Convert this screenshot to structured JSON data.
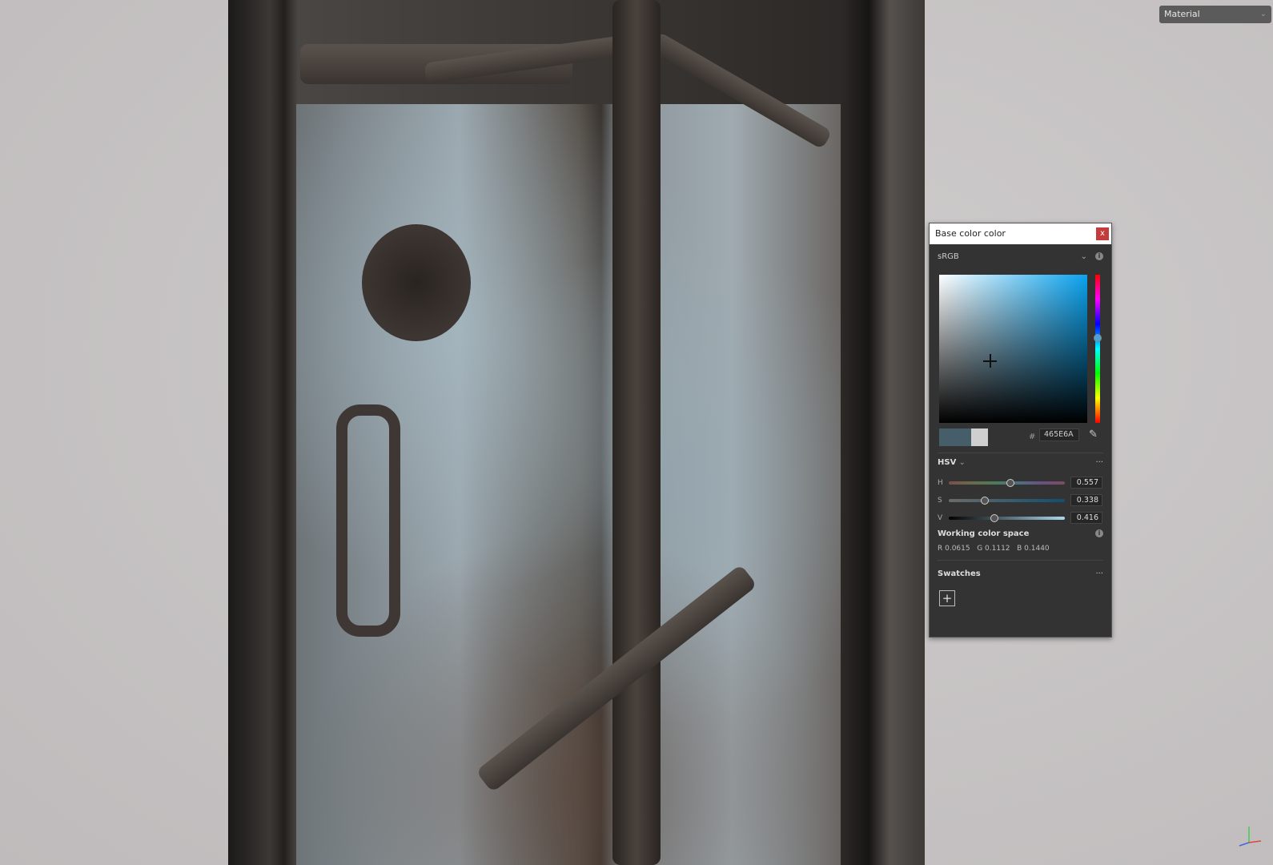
{
  "viewport": {
    "material_dropdown": "Material"
  },
  "color_dialog": {
    "title": "Base color color",
    "close": "x",
    "color_space": "sRGB",
    "hex_label": "#",
    "hex": "465E6A",
    "current_color": "#465E6A",
    "previous_color": "#CFCFCF",
    "mode": "HSV",
    "more": "···",
    "sliders": [
      {
        "label": "H",
        "value": "0.557"
      },
      {
        "label": "S",
        "value": "0.338"
      },
      {
        "label": "V",
        "value": "0.416"
      }
    ],
    "working_color_space": {
      "title": "Working color space",
      "r": "R 0.0615",
      "g": "G 0.1112",
      "b": "B 0.1440"
    },
    "swatches": {
      "title": "Swatches",
      "add": "+"
    }
  }
}
